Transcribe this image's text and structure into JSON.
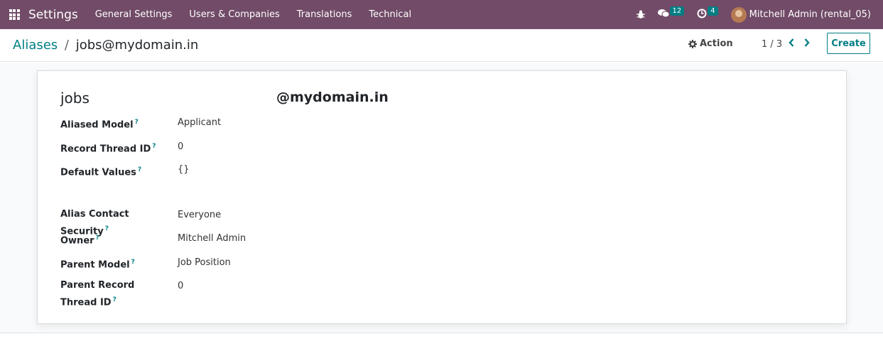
{
  "navbar": {
    "app_title": "Settings",
    "menu": [
      "General Settings",
      "Users & Companies",
      "Translations",
      "Technical"
    ],
    "messages_count": "12",
    "activities_count": "4",
    "user": "Mitchell Admin (rental_05)"
  },
  "control_panel": {
    "breadcrumb_parent": "Aliases",
    "breadcrumb_sep": "/",
    "breadcrumb_current": "jobs@mydomain.in",
    "action_label": "Action",
    "pager": "1 / 3",
    "create_label": "Create"
  },
  "form": {
    "alias_name": "jobs",
    "alias_domain": "@mydomain.in",
    "help_marker": "?",
    "fields": [
      {
        "label": "Aliased Model",
        "value": "Applicant"
      },
      {
        "label": "Record Thread ID",
        "value": "0"
      },
      {
        "label": "Default Values",
        "value": "{}"
      },
      {
        "label": "Alias Contact Security",
        "value": "Everyone"
      },
      {
        "label": "Owner",
        "value": "Mitchell Admin"
      },
      {
        "label": "Parent Model",
        "value": "Job Position"
      },
      {
        "label": "Parent Record Thread ID",
        "value": "0"
      }
    ]
  },
  "colors": {
    "navbar": "#714b67",
    "accent": "#017e84"
  },
  "icons": [
    "apps-grid-icon",
    "bug-icon",
    "chat-icon",
    "clock-icon",
    "gear-icon",
    "chevron-left-icon",
    "chevron-right-icon"
  ]
}
